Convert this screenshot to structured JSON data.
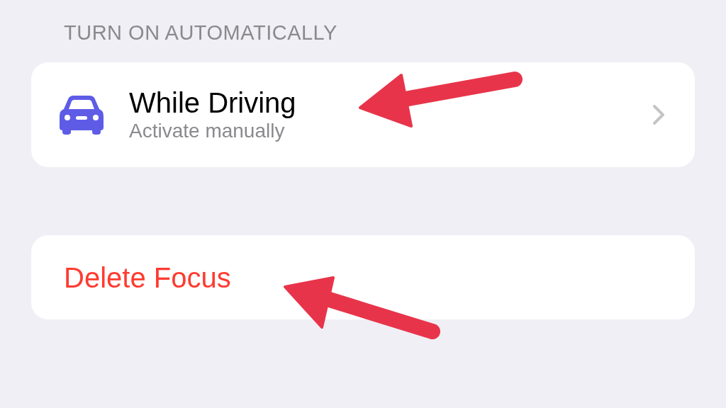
{
  "section_header": "TURN ON AUTOMATICALLY",
  "automation_row": {
    "title": "While Driving",
    "subtitle": "Activate manually",
    "has_chevron": true
  },
  "delete_button": {
    "label": "Delete Focus"
  }
}
